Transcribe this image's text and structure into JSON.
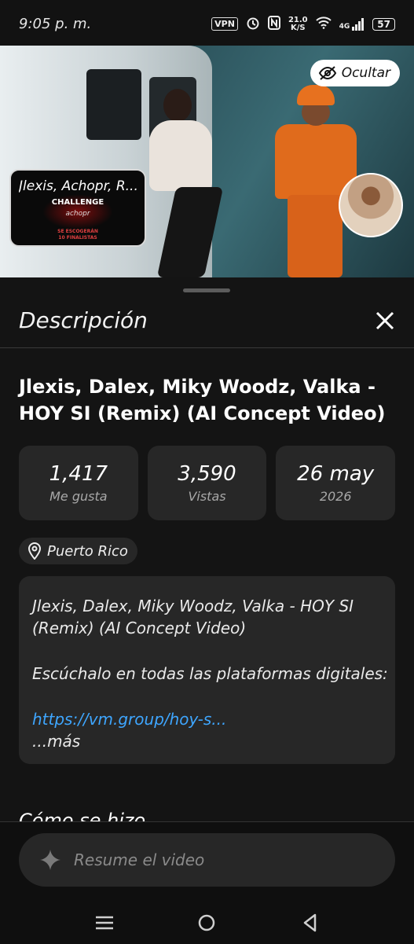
{
  "status_bar": {
    "time": "9:05 p. m.",
    "vpn": "VPN",
    "net_speed_value": "21.0",
    "net_speed_unit": "K/S",
    "network_type": "4G",
    "battery": "57",
    "icons": [
      "alarm-icon",
      "nfc-icon",
      "wifi-icon",
      "signal-icon"
    ]
  },
  "video": {
    "hide_button_label": "Ocultar",
    "playlist_card": {
      "title": "Jlexis, Achopr, R...",
      "challenge": "CHALLENGE",
      "brand": "achopr",
      "footer_line1": "SE ESCOGERÁN",
      "footer_line2": "10 FINALISTAS"
    }
  },
  "sheet": {
    "title": "Descripción",
    "video_title": "Jlexis, Dalex, Miky Woodz, Valka - HOY SI (Remix) (AI Concept Video)",
    "stats": [
      {
        "value": "1,417",
        "label": "Me gusta"
      },
      {
        "value": "3,590",
        "label": "Vistas"
      },
      {
        "value": "26 may",
        "label": "2026"
      }
    ],
    "location": "Puerto Rico",
    "description": {
      "line1": "Jlexis, Dalex, Miky Woodz, Valka - HOY SI",
      "line2": "(Remix) (AI Concept Video)",
      "line3": "Escúchalo en todas las plataformas digitales:",
      "link": "https://vm.group/hoy-s...",
      "more": "...más"
    },
    "next_section": "Cómo se hizo"
  },
  "bottom": {
    "ask_placeholder": "Resume el video"
  },
  "colors": {
    "background": "#0f0f0f",
    "card": "#272727",
    "link": "#3ea6ff"
  }
}
